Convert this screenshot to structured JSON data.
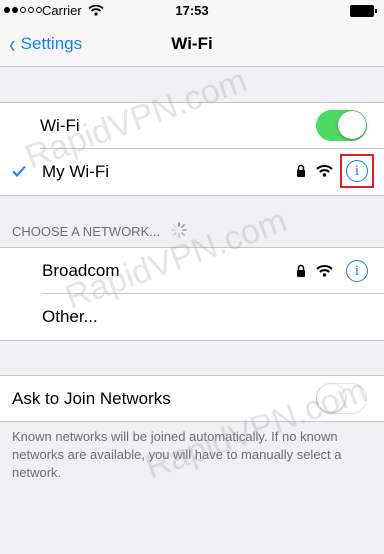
{
  "status_bar": {
    "carrier": "Carrier",
    "time": "17:53"
  },
  "nav": {
    "back_label": "Settings",
    "title": "Wi-Fi"
  },
  "wifi_toggle": {
    "label": "Wi-Fi",
    "state": "on"
  },
  "connected_network": {
    "name": "My Wi-Fi",
    "secured": true,
    "info_icon": "i"
  },
  "section_header": "CHOOSE A NETWORK...",
  "networks": [
    {
      "name": "Broadcom",
      "secured": true,
      "info_icon": "i"
    },
    {
      "name": "Other..."
    }
  ],
  "ask_to_join": {
    "label": "Ask to Join Networks",
    "state": "off"
  },
  "footer_text": "Known networks will be joined automatically. If no known networks are available, you will have to manually select a network.",
  "watermark": "RapidVPN.com",
  "colors": {
    "accent": "#157efb",
    "toggle_on": "#4cd964",
    "highlight": "#e31b23"
  }
}
